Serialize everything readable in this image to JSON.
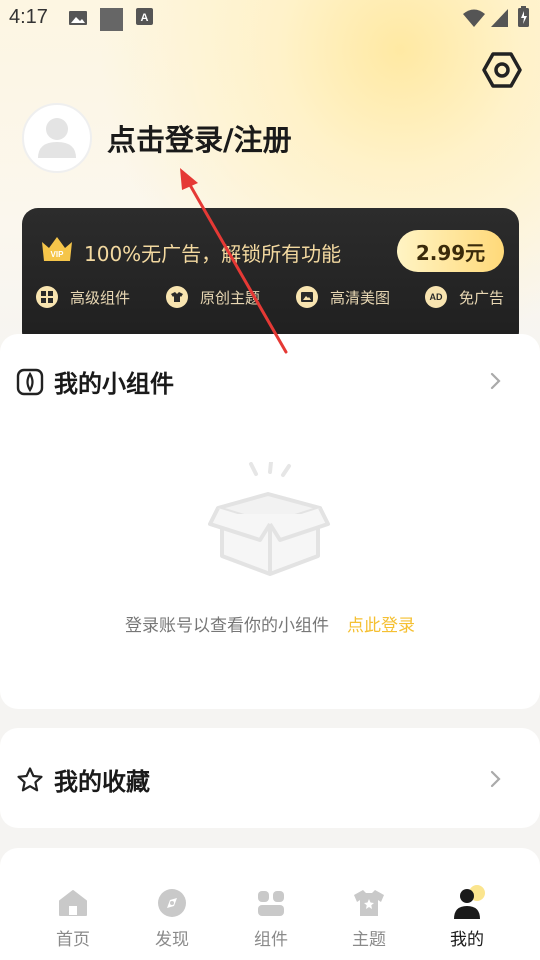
{
  "status_bar": {
    "time": "4:17"
  },
  "profile": {
    "login_label": "点击登录/注册"
  },
  "vip": {
    "title": "100%无广告，解锁所有功能",
    "price": "2.99元",
    "badge_text": "VIP",
    "features": [
      {
        "label": "高级组件",
        "icon": "widget-grid-icon"
      },
      {
        "label": "原创主题",
        "icon": "theme-icon"
      },
      {
        "label": "高清美图",
        "icon": "image-icon"
      },
      {
        "label": "免广告",
        "icon": "ad-free-icon",
        "icon_text": "AD"
      }
    ]
  },
  "widgets_section": {
    "title": "我的小组件",
    "empty_message": "登录账号以查看你的小组件",
    "login_link": "点此登录"
  },
  "favorites_section": {
    "title": "我的收藏"
  },
  "tabbar": {
    "tabs": [
      {
        "label": "首页",
        "icon": "home-icon"
      },
      {
        "label": "发现",
        "icon": "discover-icon"
      },
      {
        "label": "组件",
        "icon": "widgets-icon"
      },
      {
        "label": "主题",
        "icon": "shirt-icon"
      },
      {
        "label": "我的",
        "icon": "profile-icon",
        "active": true
      }
    ]
  },
  "colors": {
    "accent": "#f5c032",
    "vip_text": "#f3d9a0",
    "arrow": "#e53935"
  }
}
